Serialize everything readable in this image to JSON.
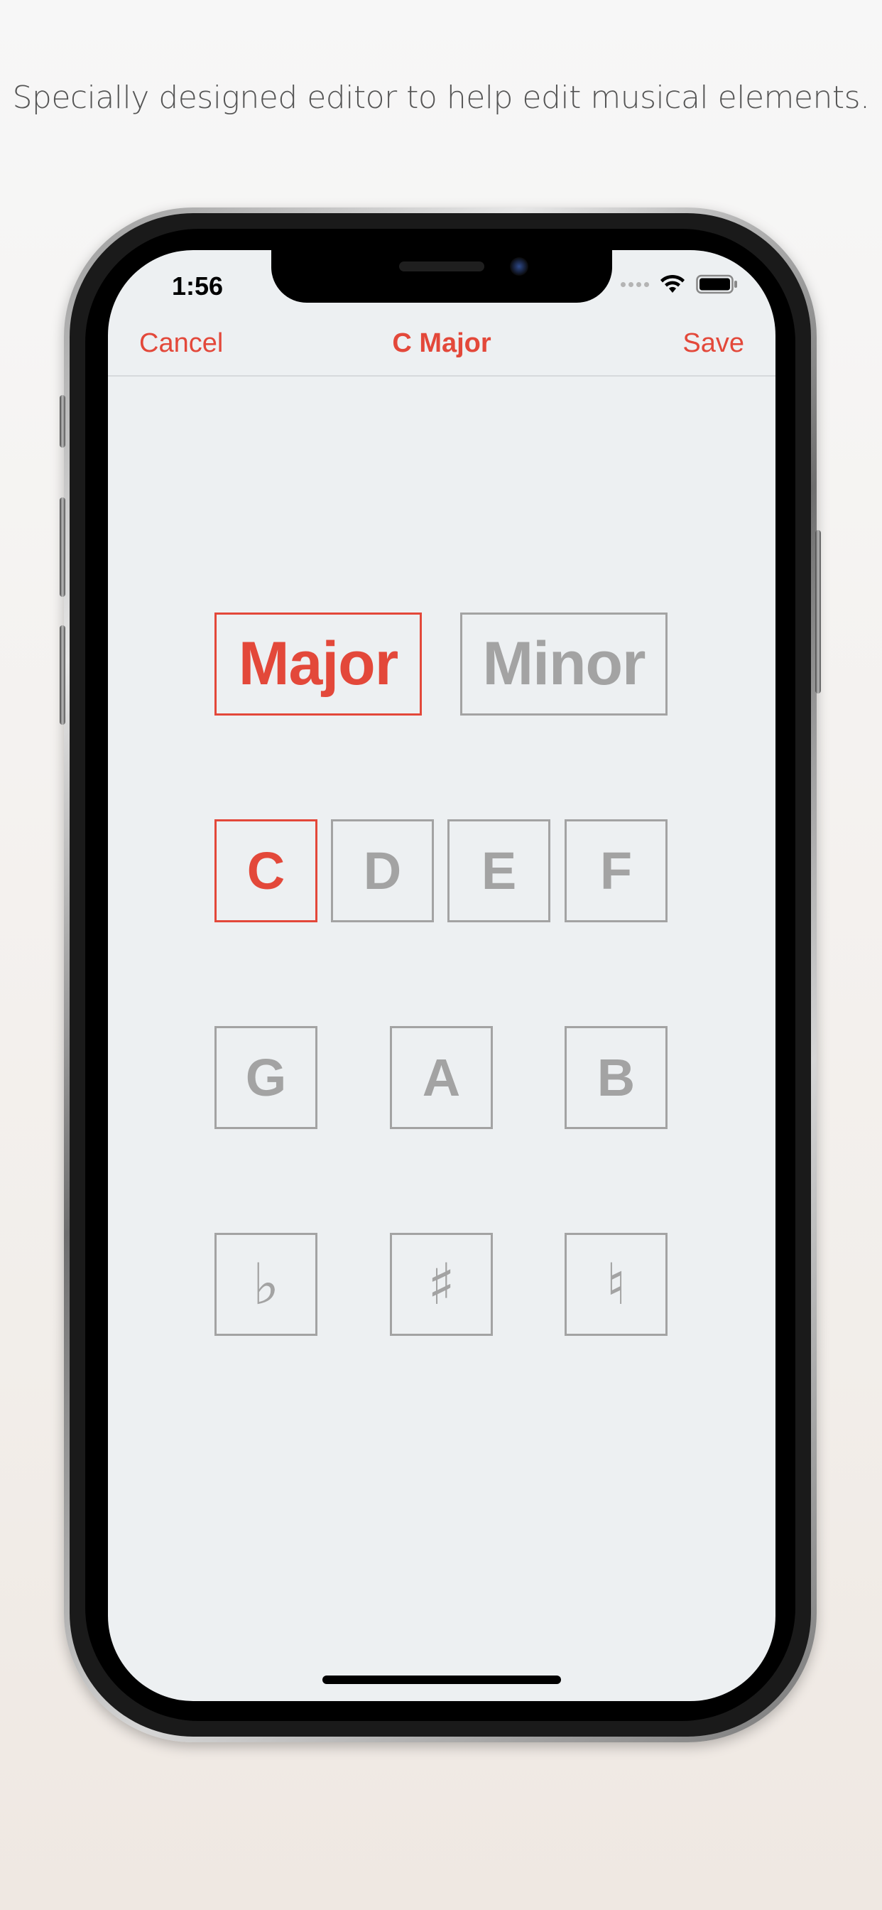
{
  "tagline": "Specially designed editor to help edit musical elements.",
  "colors": {
    "accent": "#e3483a",
    "inactive": "#a3a3a3",
    "screen_background": "#edf0f2"
  },
  "status_bar": {
    "time": "1:56",
    "icons": [
      "cellular-signal-icon",
      "wifi-icon",
      "battery-icon"
    ]
  },
  "nav": {
    "cancel_label": "Cancel",
    "title": "C Major",
    "save_label": "Save"
  },
  "modes": [
    {
      "label": "Major",
      "selected": true
    },
    {
      "label": "Minor",
      "selected": false
    }
  ],
  "keys_row1": [
    {
      "label": "C",
      "selected": true
    },
    {
      "label": "D",
      "selected": false
    },
    {
      "label": "E",
      "selected": false
    },
    {
      "label": "F",
      "selected": false
    }
  ],
  "keys_row2": [
    {
      "label": "G",
      "selected": false
    },
    {
      "label": "A",
      "selected": false
    },
    {
      "label": "B",
      "selected": false
    }
  ],
  "accidentals": [
    {
      "label": "♭",
      "name": "flat",
      "selected": false
    },
    {
      "label": "♯",
      "name": "sharp",
      "selected": false
    },
    {
      "label": "♮",
      "name": "natural",
      "selected": false
    }
  ]
}
